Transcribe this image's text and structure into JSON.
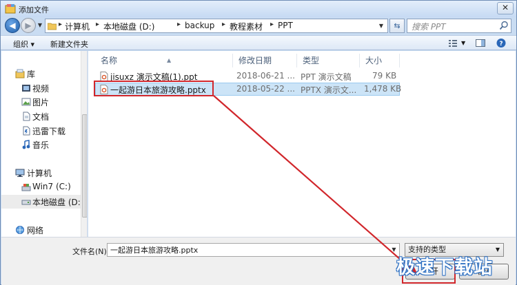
{
  "window": {
    "title": "添加文件",
    "close_label": "✕"
  },
  "address": {
    "crumbs": [
      "计算机",
      "本地磁盘 (D:)",
      "backup",
      "教程素材",
      "PPT"
    ],
    "separator": "▸"
  },
  "search": {
    "placeholder": "搜索 PPT"
  },
  "toolbar": {
    "organize_label": "组织 ▾",
    "new_folder_label": "新建文件夹"
  },
  "nav": {
    "items": [
      {
        "label": "库",
        "icon": "library-icon"
      },
      {
        "label": "视频",
        "icon": "video-icon"
      },
      {
        "label": "图片",
        "icon": "picture-icon"
      },
      {
        "label": "文档",
        "icon": "document-icon"
      },
      {
        "label": "迅雷下载",
        "icon": "download-folder-icon"
      },
      {
        "label": "音乐",
        "icon": "music-icon"
      },
      {
        "label": "计算机",
        "icon": "computer-icon"
      },
      {
        "label": "Win7 (C:)",
        "icon": "drive-icon"
      },
      {
        "label": "本地磁盘 (D:",
        "icon": "drive-icon"
      },
      {
        "label": "网络",
        "icon": "network-icon"
      }
    ],
    "selected_index": 8
  },
  "columns": {
    "name": "名称",
    "modified": "修改日期",
    "type": "类型",
    "size": "大小"
  },
  "files": [
    {
      "name": "jisuxz 演示文稿(1).ppt",
      "modified": "2018-06-21 ...",
      "type": "PPT 演示文稿",
      "size": "79 KB",
      "selected": false
    },
    {
      "name": "一起游日本旅游攻略.pptx",
      "modified": "2018-05-22 ...",
      "type": "PPTX 演示文...",
      "size": "1,478 KB",
      "selected": true
    }
  ],
  "bottom": {
    "filename_label": "文件名(N):",
    "filename_value": "一起游日本旅游攻略.pptx",
    "filetype_value": "支持的类型",
    "open_label": "打开",
    "cancel_label": "取消"
  },
  "watermark": "极速下载站",
  "colors": {
    "accent": "#1f5ea8",
    "annotation": "#d1262b",
    "selection": "#cce4f7"
  }
}
